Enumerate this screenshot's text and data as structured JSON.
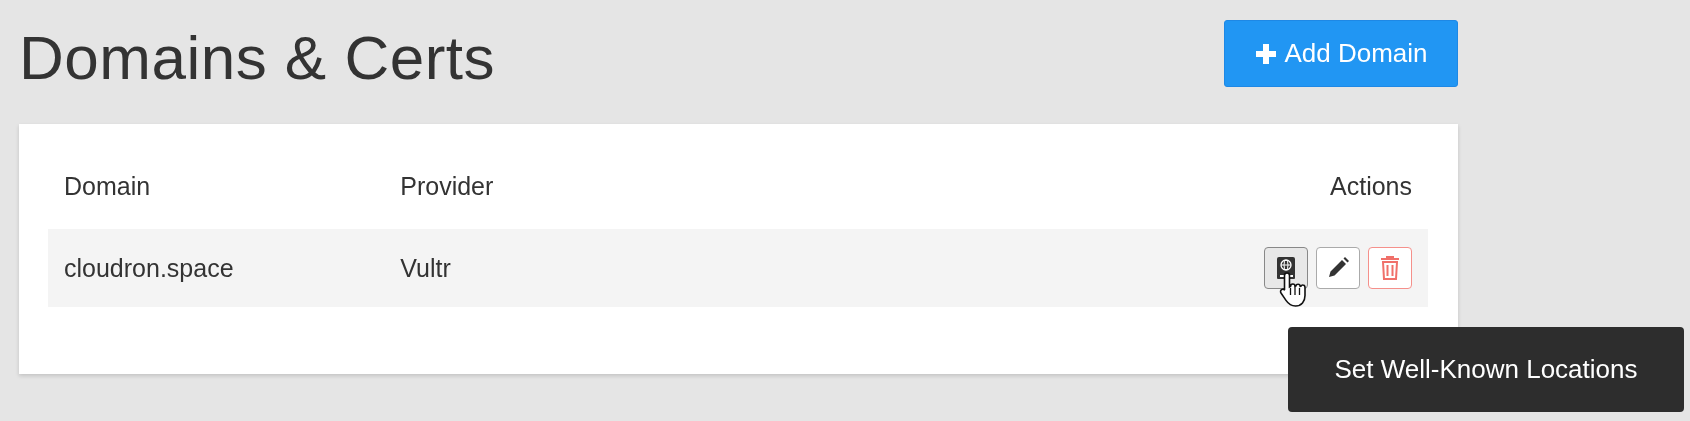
{
  "page": {
    "title": "Domains & Certs",
    "add_button": "Add Domain"
  },
  "table": {
    "columns": [
      "Domain",
      "Provider",
      "Actions"
    ],
    "rows": [
      {
        "domain": "cloudron.space",
        "provider": "Vultr",
        "actions": [
          {
            "kind": "wellknown",
            "hovered": true
          },
          {
            "kind": "edit",
            "hovered": false
          },
          {
            "kind": "delete",
            "hovered": false
          }
        ]
      }
    ]
  },
  "tooltip": {
    "text": "Set Well-Known Locations"
  }
}
